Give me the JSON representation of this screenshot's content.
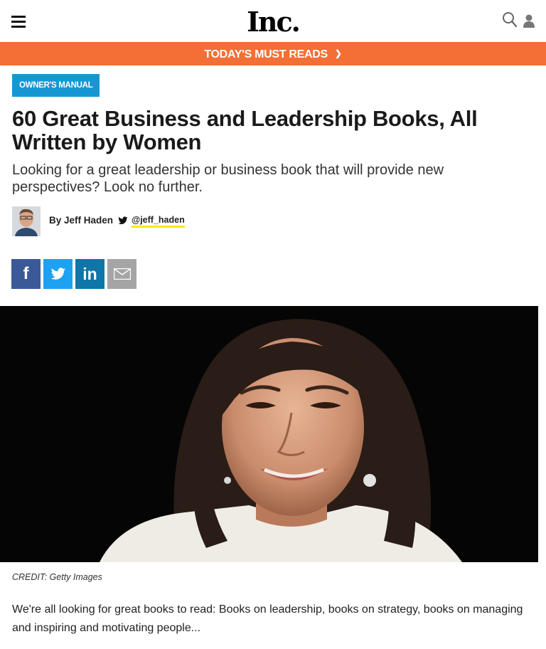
{
  "header": {
    "logo_text": "Inc.",
    "menu_icon": "hamburger-menu-icon",
    "search_icon": "search-icon",
    "user_icon": "user-icon"
  },
  "banner": {
    "label": "TODAY'S MUST READS",
    "chevron": "chevron-down-icon",
    "color": "#f36f36"
  },
  "article": {
    "category": "OWNER'S MANUAL",
    "category_color": "#1797d2",
    "headline": "60 Great Business and Leadership Books, All Written by Women",
    "dek": "Looking for a great leadership or business book that will provide new perspectives? Look no further.",
    "byline": "By Jeff Haden",
    "twitter_handle": "@jeff_haden",
    "credit": "CREDIT: Getty Images",
    "body": "We're all looking for great books to read: Books on leadership, books on strategy, books on managing and inspiring and motivating people..."
  },
  "share": {
    "facebook": "f",
    "twitter": "twitter-icon",
    "linkedin": "in",
    "email": "email-icon",
    "colors": {
      "facebook": "#3b5998",
      "twitter": "#1da1f2",
      "linkedin": "#0e76a8",
      "email": "#a5a5a5"
    }
  }
}
